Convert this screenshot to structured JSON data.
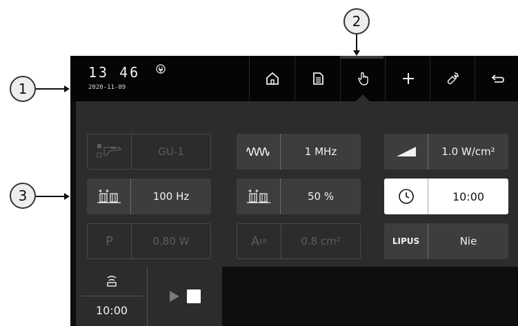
{
  "callouts": {
    "c1": "1",
    "c2": "2",
    "c3": "3"
  },
  "status": {
    "time": "13 46",
    "date": "2020-11-09"
  },
  "nav": {
    "items": [
      "home-icon",
      "document-icon",
      "hand-icon",
      "plus-icon",
      "wrench-icon",
      "back-icon"
    ],
    "active": "hand-icon"
  },
  "params": {
    "applicator": {
      "value": "GU-1",
      "state": "disabled"
    },
    "frequency": {
      "value": "1 MHz",
      "state": "enabled"
    },
    "intensity": {
      "value": "1.0 W/cm²",
      "state": "enabled"
    },
    "pulse_frequency": {
      "value": "100 Hz",
      "state": "enabled"
    },
    "duty_cycle": {
      "value": "50 %",
      "state": "enabled"
    },
    "time": {
      "value": "10:00",
      "state": "selected"
    },
    "power": {
      "label": "P",
      "value": "0.80 W",
      "state": "disabled"
    },
    "area": {
      "label": "A",
      "label_sub": "ER",
      "value": "0.8 cm²",
      "state": "disabled"
    },
    "lipus": {
      "label": "LIPUS",
      "value": "Nie",
      "state": "enabled"
    }
  },
  "treatment": {
    "time": "10:00"
  },
  "colors": {
    "screen_bg": "#0e0e0e",
    "panel_bg": "#2c2c2c",
    "tile_bg": "#3d3d3d",
    "selected_bg": "#ffffff",
    "disabled_text": "#5d5d5d"
  }
}
